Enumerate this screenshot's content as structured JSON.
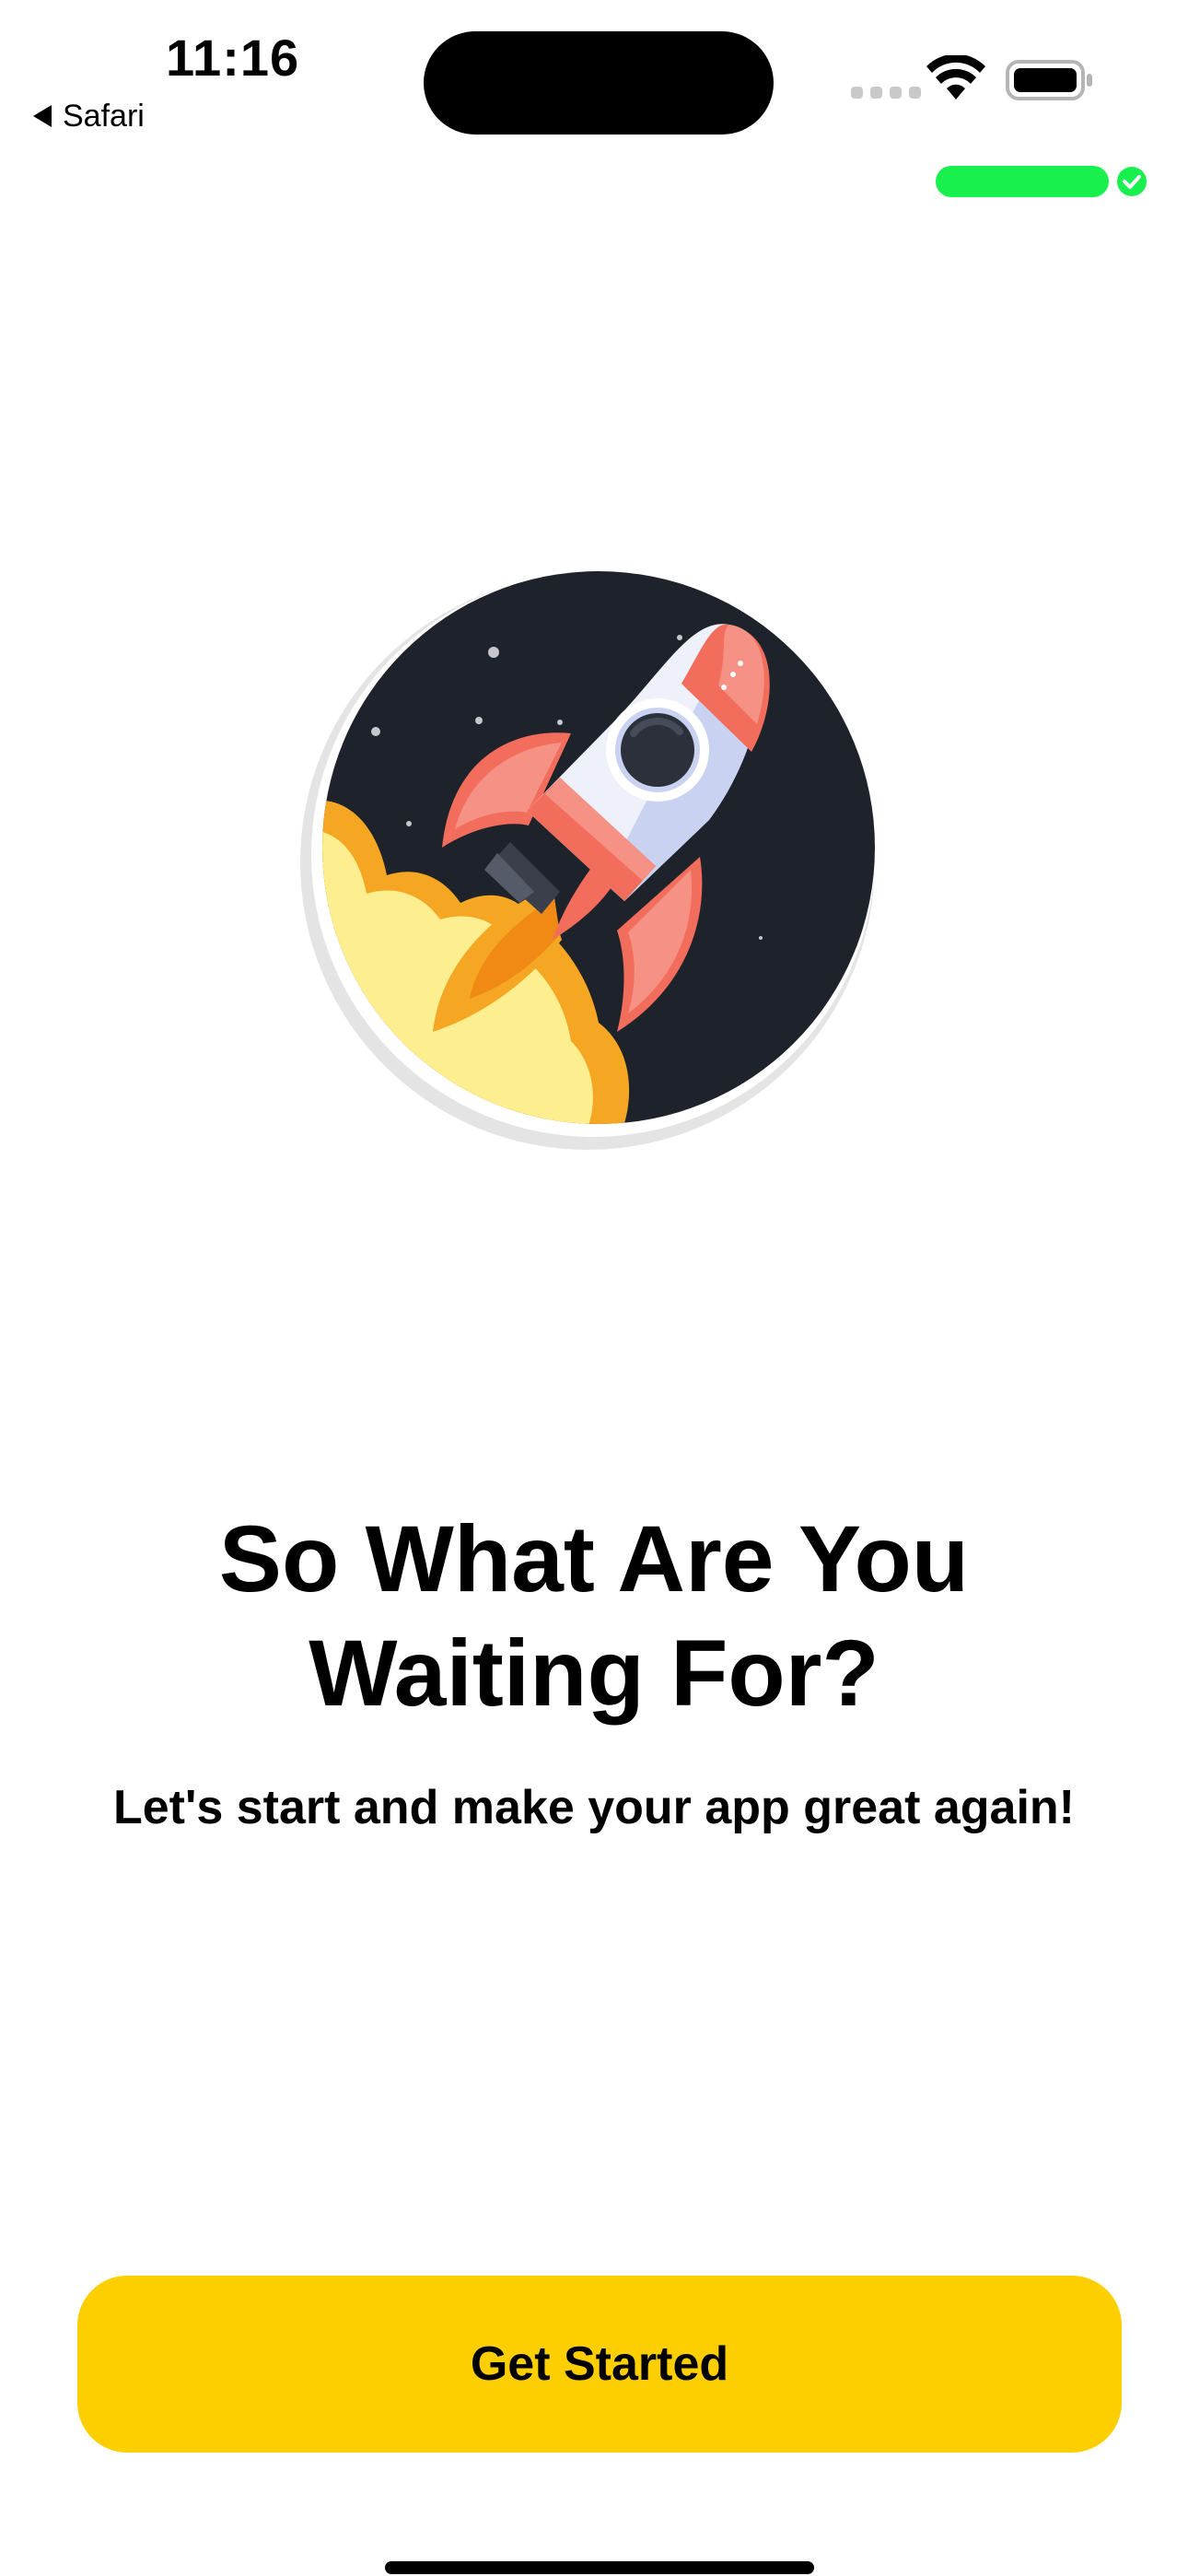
{
  "status_bar": {
    "time": "11:16",
    "back_label": "Safari"
  },
  "hero": {
    "illustration": "rocket-launch-illustration"
  },
  "content": {
    "headline_line1": "So What Are You",
    "headline_line2": "Waiting For?",
    "subline": "Let's start and make your app great again!"
  },
  "cta": {
    "label": "Get Started"
  },
  "colors": {
    "accent": "#fdce00",
    "recording": "#17f04d",
    "text": "#000000",
    "background": "#ffffff"
  }
}
